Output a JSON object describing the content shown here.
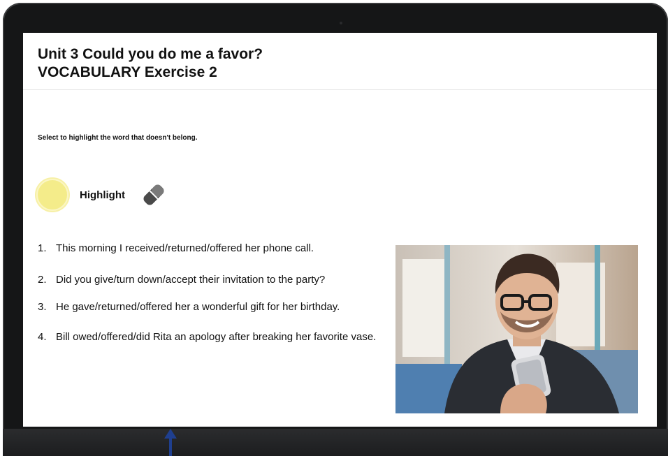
{
  "header": {
    "title_line1": "Unit 3 Could you do me a favor?",
    "title_line2": "VOCABULARY Exercise 2"
  },
  "instruction": "Select to highlight the word that doesn't belong.",
  "tools": {
    "highlight_label": "Highlight",
    "highlight_icon": "highlighter-circle-icon",
    "eraser_icon": "eraser-icon",
    "highlight_color": "#f4ec8a"
  },
  "items": [
    {
      "number": "1.",
      "text": "This morning I received/returned/offered her phone call."
    },
    {
      "number": "2.",
      "text": "Did you give/turn down/accept their invitation to the party?"
    },
    {
      "number": "3.",
      "text": "He gave/returned/offered her a wonderful gift for her birthday."
    },
    {
      "number": "4.",
      "text": "Bill owed/offered/did Rita an apology after breaking her favorite vase."
    }
  ],
  "colors": {
    "bezel": "#151617",
    "arrow": "#1f3f8f"
  }
}
